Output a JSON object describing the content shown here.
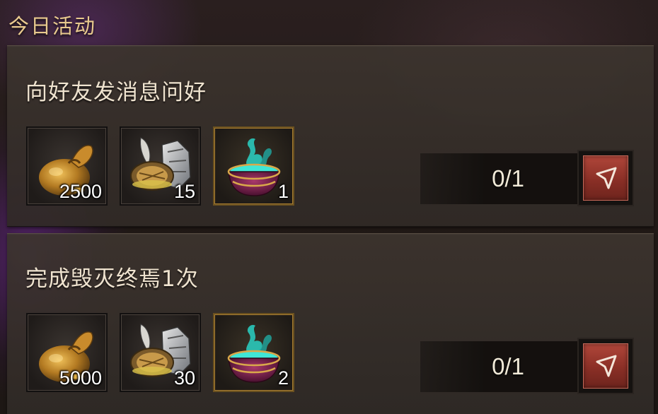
{
  "section": {
    "title": "今日活动"
  },
  "tasks": [
    {
      "title": "向好友发消息问好",
      "rewards": [
        {
          "icon": "coin-pouch-icon",
          "qty": "2500"
        },
        {
          "icon": "shield-gear-icon",
          "qty": "15"
        },
        {
          "icon": "potion-cauldron-icon",
          "qty": "1"
        }
      ],
      "progress": "0/1",
      "go_icon": "navigate-arrow-icon"
    },
    {
      "title": "完成毁灭终焉1次",
      "rewards": [
        {
          "icon": "coin-pouch-icon",
          "qty": "5000"
        },
        {
          "icon": "shield-gear-icon",
          "qty": "30"
        },
        {
          "icon": "potion-cauldron-icon",
          "qty": "2"
        }
      ],
      "progress": "0/1",
      "go_icon": "navigate-arrow-icon"
    }
  ],
  "colors": {
    "title": "#e8c98e",
    "task_title": "#efe3cf",
    "go_button": "#9a382d",
    "rare_frame": "#a77d32"
  }
}
